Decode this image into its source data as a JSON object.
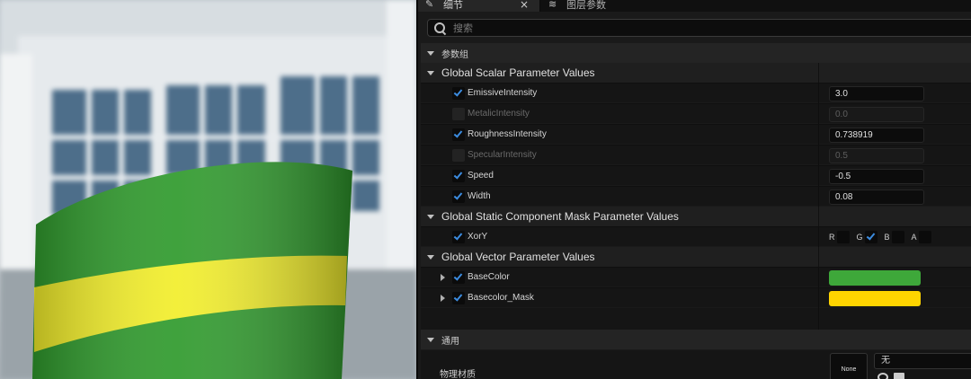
{
  "tabs": [
    {
      "label": "细节",
      "icon": "pencil-icon",
      "closable": true,
      "close_glyph": "×"
    },
    {
      "label": "图层参数",
      "icon": "layers-icon"
    }
  ],
  "search": {
    "placeholder": "搜索"
  },
  "parameter_groups_header": "参数组",
  "groups": [
    {
      "title": "Global Scalar Parameter Values",
      "rows": [
        {
          "name": "EmissiveIntensity",
          "enabled": true,
          "value": "3.0"
        },
        {
          "name": "MetalicIntensity",
          "enabled": false,
          "value": "0.0"
        },
        {
          "name": "RoughnessIntensity",
          "enabled": true,
          "value": "0.738919"
        },
        {
          "name": "SpecularIntensity",
          "enabled": false,
          "value": "0.5"
        },
        {
          "name": "Speed",
          "enabled": true,
          "value": "-0.5"
        },
        {
          "name": "Width",
          "enabled": true,
          "value": "0.08"
        }
      ]
    },
    {
      "title": "Global Static Component Mask Parameter Values",
      "rows": [
        {
          "name": "XorY",
          "enabled": true,
          "mask": [
            {
              "label": "R",
              "checked": false
            },
            {
              "label": "G",
              "checked": true
            },
            {
              "label": "B",
              "checked": false
            },
            {
              "label": "A",
              "checked": false
            }
          ]
        }
      ]
    },
    {
      "title": "Global Vector Parameter Values",
      "rows": [
        {
          "name": "BaseColor",
          "enabled": true,
          "color": "#3ea83a"
        },
        {
          "name": "Basecolor_Mask",
          "enabled": true,
          "color": "#ffd400"
        }
      ]
    }
  ],
  "general": {
    "header": "通用",
    "physical_material_label": "物理材质",
    "thumbnail_text": "None",
    "combo_value": "无"
  },
  "colors": {
    "accent_check": "#3c8ce0",
    "pillar_green": "#2f9a2c",
    "pillar_yellow": "#f2ee2a"
  }
}
